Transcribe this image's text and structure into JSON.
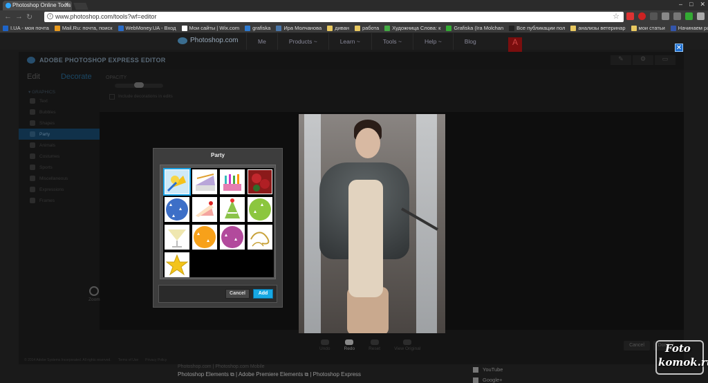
{
  "browser": {
    "tab_title": "Photoshop Online Tools",
    "url": "www.photoshop.com/tools?wf=editor",
    "bookmarks": [
      {
        "label": "I.UA - моя почта",
        "color": "#1e64c8"
      },
      {
        "label": "Mail.Ru: почта, поиск",
        "color": "#e89a1e"
      },
      {
        "label": "WebMoney.UA - Вход",
        "color": "#2a6cc8"
      },
      {
        "label": "Мои сайты | Wix.com",
        "color": "#ffffff"
      },
      {
        "label": "grafiska",
        "color": "#2e7ad0"
      },
      {
        "label": "Ира Молчанова",
        "color": "#4a76a8"
      },
      {
        "label": "диван",
        "color": "#e8c860"
      },
      {
        "label": "работа",
        "color": "#e8c860"
      },
      {
        "label": "Художница Слова: к",
        "color": "#44aa44"
      },
      {
        "label": "Grafiska (Ira Molchan",
        "color": "#33aa33"
      },
      {
        "label": "Все публикации пол",
        "color": "#222222"
      },
      {
        "label": "анализы ветеринар",
        "color": "#e8c860"
      },
      {
        "label": "мои статьи",
        "color": "#e8c860"
      },
      {
        "label": "Начинаем работу с р",
        "color": "#3355aa"
      }
    ]
  },
  "site": {
    "logo_text": "Photoshop.com",
    "nav": [
      "Me",
      "Products ~",
      "Learn ~",
      "Tools ~",
      "Help ~",
      "Blog"
    ]
  },
  "editor": {
    "title": "ADOBE PHOTOSHOP EXPRESS EDITOR",
    "tabs": {
      "edit": "Edit",
      "decorate": "Decorate"
    },
    "graphics_header": "▾ GRAPHICS",
    "menu": [
      "Text",
      "Bubbles",
      "Shapes",
      "Party",
      "Animals",
      "Costumes",
      "Sports",
      "Miscellaneous",
      "Expressions",
      "Frames"
    ],
    "active_menu": "Party",
    "opacity_label": "OPACITY",
    "include_label": "Include decorations in edits",
    "zoom_label": "Zoom",
    "bottom_tools": [
      "Undo",
      "Redo",
      "Reset",
      "View Original"
    ],
    "cancel": "Cancel",
    "done": "Done",
    "legal": [
      "© 2014 Adobe Systems Incorporated. All rights reserved.",
      "Terms of Use",
      "Privacy Policy"
    ]
  },
  "dialog": {
    "title": "Party",
    "cancel": "Cancel",
    "add": "Add",
    "thumbnails": [
      "party-favors",
      "party-tent",
      "birthday-candles",
      "rose-bouquet",
      "blue-balloon",
      "cake-slice",
      "party-hat",
      "green-balloon",
      "champagne-glass",
      "orange-balloon",
      "purple-balloon",
      "gold-swirl",
      "gold-star"
    ],
    "selected_index": 0
  },
  "footer": {
    "tagline": "Photoshop.com | Photoshop.com Mobile",
    "links": "Photoshop Elements ⧉  |  Adobe Premiere Elements ⧉  |  Photoshop Express",
    "social": [
      "YouTube",
      "Google+"
    ]
  },
  "watermark": {
    "line1": "Foto",
    "line2": "komok.ru"
  }
}
